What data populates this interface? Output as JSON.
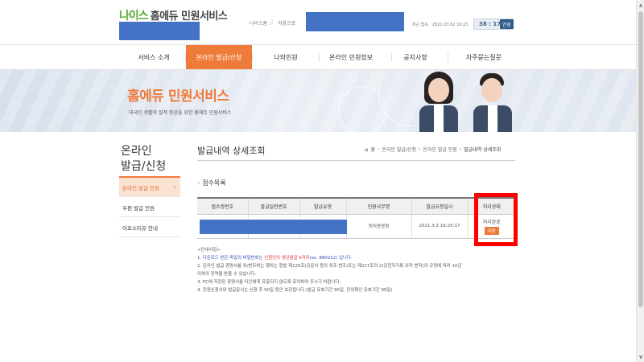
{
  "header": {
    "logo_neis": "나이스",
    "logo_text": "홈에듀 민원서비스",
    "label_neis": "나이스홈 :",
    "label_login": "처음으로",
    "last_login": "최근 접속 : 2021.03.02 16:23",
    "timer": "38 : 17",
    "extend": "연장"
  },
  "nav": {
    "items": [
      {
        "label": "서비스 소개"
      },
      {
        "label": "온라인 발급/신청"
      },
      {
        "label": "나의민원"
      },
      {
        "label": "온라인 민원정보"
      },
      {
        "label": "공지사항"
      },
      {
        "label": "자주묻는질문"
      }
    ]
  },
  "banner": {
    "title": "홈에듀 민원서비스",
    "subtitle": "대국민 생활의 질적 향상을 위한 홈에듀 민원서비스"
  },
  "sidebar": {
    "title_line1": "온라인",
    "title_line2": "발급/신청",
    "items": [
      {
        "label": "온라인 발급 민원",
        "chevron": "›"
      },
      {
        "label": "우편 발급 민원"
      },
      {
        "label": "아포스티유 안내"
      }
    ]
  },
  "content": {
    "title": "발급내역 상세조회",
    "breadcrumb": [
      "홈",
      "온라인 발급/신청",
      "온라인 발급 민원",
      "발급내역 상세조회"
    ],
    "breadcrumb_sep": "›",
    "section_title": "접수목록",
    "table": {
      "headers": [
        "접수증번호",
        "발급일련번호",
        "발급유형",
        "민원사무명",
        "발급요청일시",
        "처리상태"
      ],
      "rows": [
        {
          "doc_name": "퇴직증명원",
          "requested_at": "2021.3.2 16:25:17",
          "status": "처리완료",
          "status_btn": "저장"
        }
      ]
    },
    "notes": {
      "heading": "<안내사항>",
      "line1_prefix": "1. ",
      "line1_hl": "다운로드 받은 파일의 비밀번호는 ",
      "line1_red": "신청인의 생년월일 6자리",
      "line1_suffix": "(ex. 880212) 입니다.",
      "line2": "2. 온라인 발급 증명서를 위/변조하는 행위는 형법 제225조(공문서 등의 위조·변조)또는 제227조의 2(공전자기록 위작·변작)의 규정에 따라 10년",
      "line2b": "이하의 징역을 받을 수 있습니다.",
      "line3": "3. PC에 저장된 증명서를 타인에게 유출되지 않도록 유의하여 주시기 바랍니다.",
      "line4": "4. 민원신청서와 발급문서는 신청 후 90일 동안 보관됩니다.(발급 유효기간 90일, 진위확인 유효기간 90일)"
    }
  },
  "colors": {
    "accent": "#ef7b3a",
    "redact": "#4472c4",
    "highlight_box": "#ff0000"
  }
}
